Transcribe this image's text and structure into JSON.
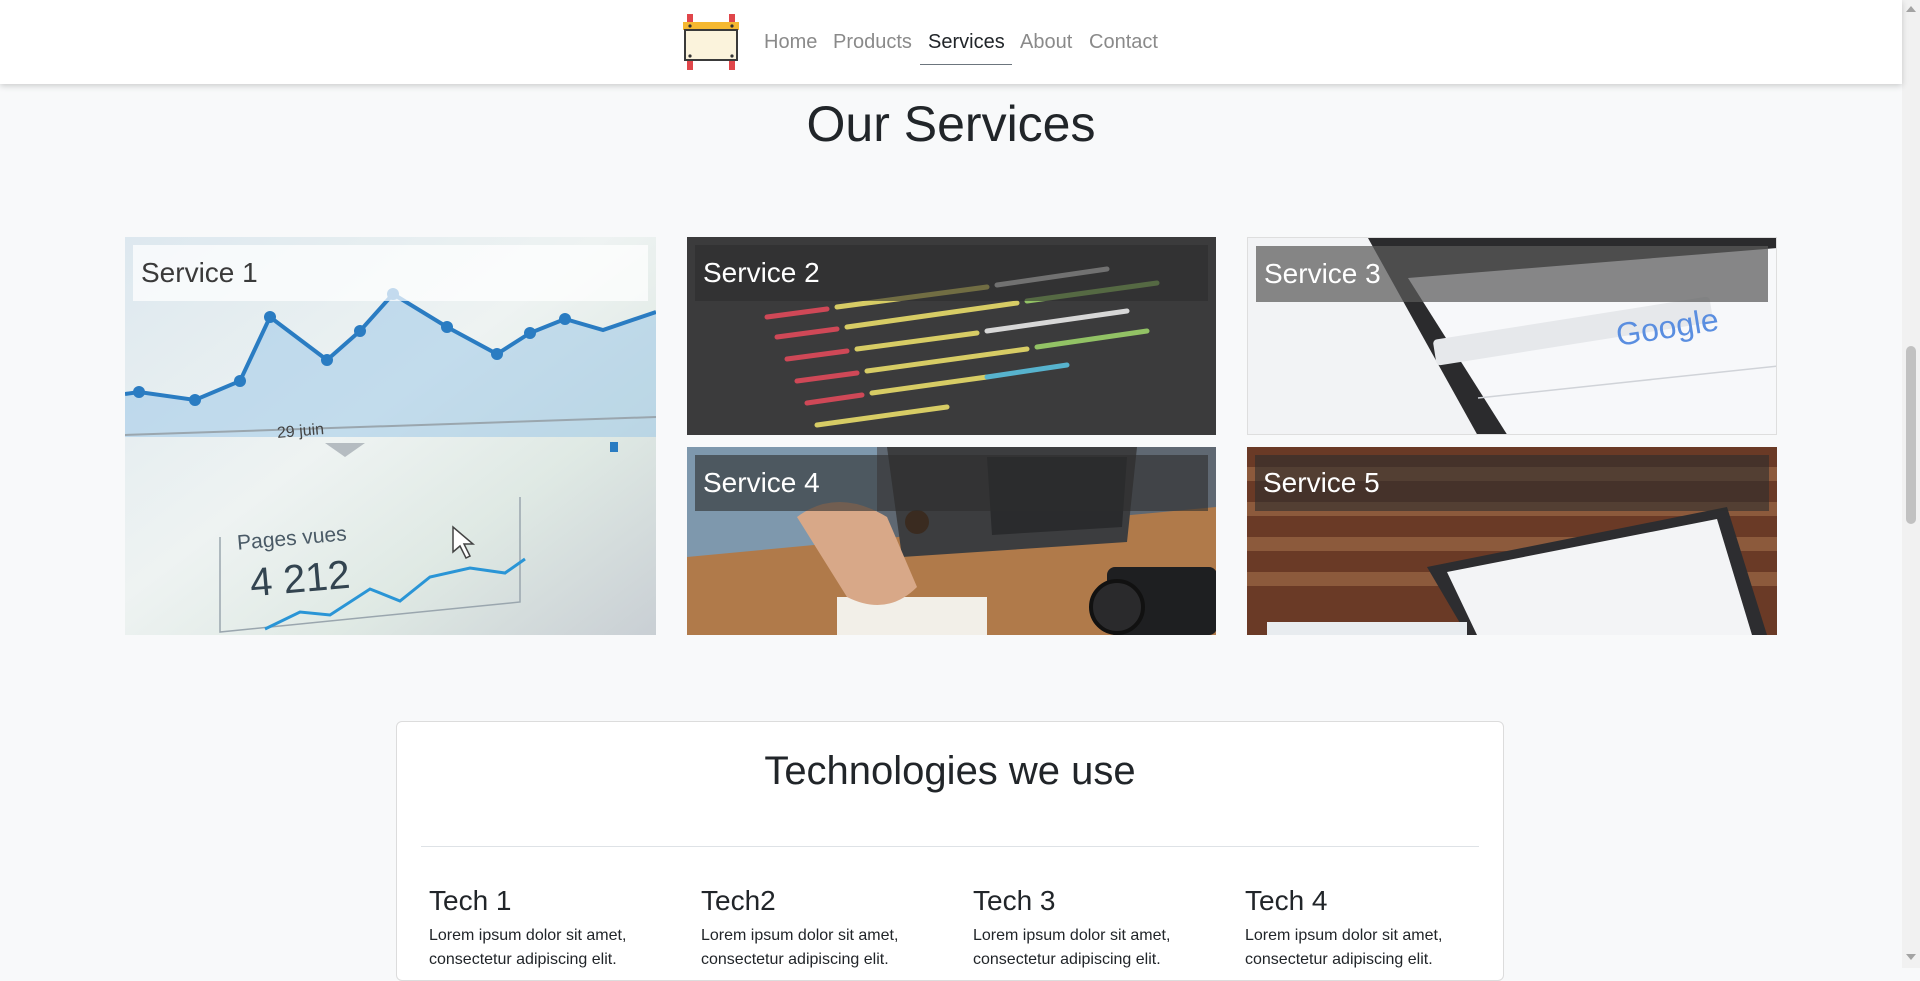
{
  "nav": {
    "logo_name": "construction-sign-logo",
    "links": [
      "Home",
      "Products",
      "Services",
      "About",
      "Contact"
    ],
    "active": "Services"
  },
  "services": {
    "title": "Our Services",
    "items": [
      "Service 1",
      "Service 2",
      "Service 3",
      "Service 4",
      "Service 5"
    ]
  },
  "chart_overlay": {
    "date_label": "29 juin",
    "pages_label": "Pages vues",
    "pages_value": "4 212"
  },
  "tech": {
    "title": "Technologies we use",
    "items": [
      {
        "name": "Tech 1",
        "desc": "Lorem ipsum dolor sit amet, consectetur adipiscing elit."
      },
      {
        "name": "Tech2",
        "desc": "Lorem ipsum dolor sit amet, consectetur adipiscing elit."
      },
      {
        "name": "Tech 3",
        "desc": "Lorem ipsum dolor sit amet, consectetur adipiscing elit."
      },
      {
        "name": "Tech 4",
        "desc": "Lorem ipsum dolor sit amet, consectetur adipiscing elit."
      }
    ]
  },
  "colors": {
    "nav_active": "#212529",
    "nav_inactive": "#8a8a8a",
    "page_bg": "#f8f9fa"
  }
}
